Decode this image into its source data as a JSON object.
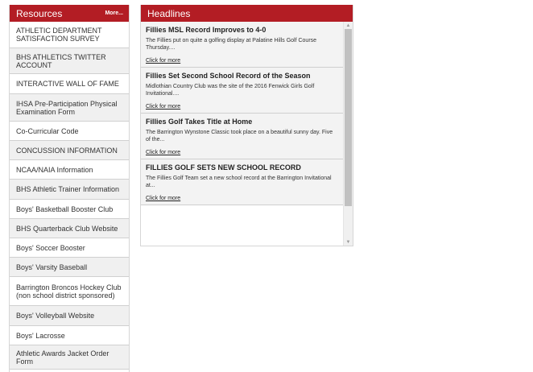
{
  "resources": {
    "title": "Resources",
    "more_label": "More...",
    "items": [
      {
        "label": "ATHLETIC DEPARTMENT SATISFACTION SURVEY"
      },
      {
        "label": "BHS ATHLETICS TWITTER ACCOUNT"
      },
      {
        "label": "INTERACTIVE WALL OF FAME"
      },
      {
        "label": "IHSA Pre-Participation Physical Examination Form"
      },
      {
        "label": "Co-Curricular Code"
      },
      {
        "label": "CONCUSSION INFORMATION"
      },
      {
        "label": "NCAA/NAIA Information"
      },
      {
        "label": "BHS Athletic Trainer Information"
      },
      {
        "label": "Boys' Basketball Booster Club"
      },
      {
        "label": "BHS Quarterback Club Website"
      },
      {
        "label": "Boys' Soccer Booster"
      },
      {
        "label": "Boys' Varsity Baseball"
      },
      {
        "label": "Barrington Broncos Hockey Club (non school district sponsored)"
      },
      {
        "label": "Boys' Volleyball Website"
      },
      {
        "label": "Boys' Lacrosse"
      },
      {
        "label": "Athletic Awards Jacket Order Form"
      }
    ]
  },
  "headlines": {
    "title": "Headlines",
    "items": [
      {
        "title": "Fillies MSL Record Improves to 4-0",
        "summary": "The Fillies put on quite a golfing display at Palatine Hills Golf Course Thursday....",
        "link": "Click for more"
      },
      {
        "title": "Fillies Set Second School Record of the Season",
        "summary": "Midlothian Country Club was the site of the 2016 Fenwick Girls Golf Invitational....",
        "link": "Click for more"
      },
      {
        "title": "Fillies Golf Takes Title at Home",
        "summary": "The Barrington Wynstone Classic took place on a beautiful sunny day. Five of the...",
        "link": "Click for more"
      },
      {
        "title": "FILLIES GOLF SETS NEW SCHOOL RECORD",
        "summary": "The Fillies Golf Team set a new school record at the Barrington Invitational at...",
        "link": "Click for more"
      }
    ]
  },
  "icons": {
    "scroll_up": "triangle-up",
    "scroll_down": "triangle-down"
  },
  "colors": {
    "header_red": "#b31d24"
  }
}
